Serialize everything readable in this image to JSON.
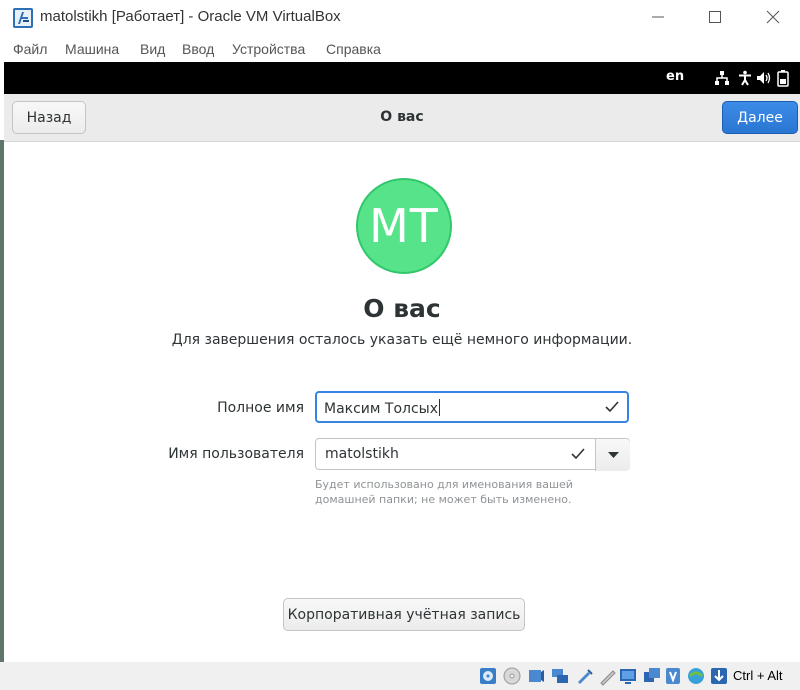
{
  "window": {
    "title": "matolstikh [Работает] - Oracle VM VirtualBox",
    "controls": [
      "minimize",
      "maximize",
      "close"
    ]
  },
  "menu": [
    {
      "label": "Файл"
    },
    {
      "label": "Машина"
    },
    {
      "label": "Вид"
    },
    {
      "label": "Ввод"
    },
    {
      "label": "Устройства"
    },
    {
      "label": "Справка"
    }
  ],
  "guest_topbar": {
    "language": "en",
    "tray_icons": [
      "network-icon",
      "accessibility-icon",
      "volume-icon",
      "battery-icon"
    ]
  },
  "headerbar": {
    "back_label": "Назад",
    "title": "О вас",
    "next_label": "Далее",
    "accent_color": "#3584e4"
  },
  "page": {
    "avatar_initials": "MT",
    "avatar_color": "#57e389",
    "heading": "О вас",
    "subtitle": "Для завершения осталось указать ещё немного информации.",
    "full_name": {
      "label": "Полное имя",
      "value": "Максим Толсых",
      "valid": true
    },
    "username": {
      "label": "Имя пользователя",
      "value": "matolstikh",
      "valid": true,
      "hint": "Будет использовано для именования вашей домашней папки; не может быть изменено."
    },
    "enterprise_button": "Корпоративная учётная запись"
  },
  "statusbar": {
    "icons": [
      "hard-disk-icon",
      "optical-disk-icon",
      "audio-icon",
      "network-adapter-icon",
      "usb-icon",
      "shared-folders-icon",
      "display-icon",
      "recording-icon",
      "virtualization-icon",
      "mouse-integration-icon",
      "keyboard-capture-icon"
    ],
    "host_key": "Ctrl + Alt"
  }
}
